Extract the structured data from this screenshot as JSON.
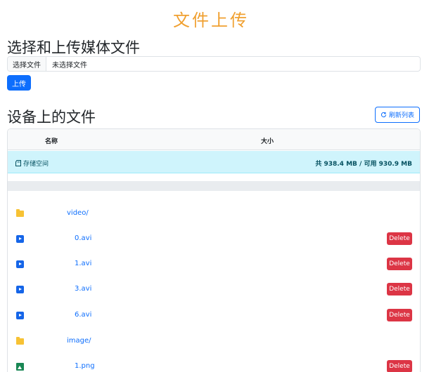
{
  "page": {
    "title": "文件上传",
    "upload_section": {
      "heading": "选择和上传媒体文件",
      "choose_file_label": "选择文件",
      "no_file_selected": "未选择文件",
      "upload_label": "上传"
    },
    "files_section": {
      "heading": "设备上的文件",
      "refresh_label": "刷新列表"
    }
  },
  "table": {
    "columns": {
      "name": "名称",
      "size": "大小"
    },
    "storage": {
      "label": "存储空间",
      "summary": "共 938.4 MB / 可用 930.9 MB"
    },
    "delete_label": "Delete",
    "rows": [
      {
        "type": "folder",
        "name": "video/",
        "icon": "folder-icon"
      },
      {
        "type": "video",
        "name": "0.avi",
        "icon": "video-file-icon"
      },
      {
        "type": "video",
        "name": "1.avi",
        "icon": "video-file-icon"
      },
      {
        "type": "video",
        "name": "3.avi",
        "icon": "video-file-icon"
      },
      {
        "type": "video",
        "name": "6.avi",
        "icon": "video-file-icon"
      },
      {
        "type": "folder",
        "name": "image/",
        "icon": "folder-icon"
      },
      {
        "type": "image",
        "name": "1.png",
        "icon": "image-file-icon"
      }
    ]
  },
  "colors": {
    "title": "#f0a030",
    "primary": "#0d6efd",
    "danger": "#dc3545",
    "info_bg": "#cff4fc",
    "folder": "#f7c234",
    "image": "#198754"
  }
}
